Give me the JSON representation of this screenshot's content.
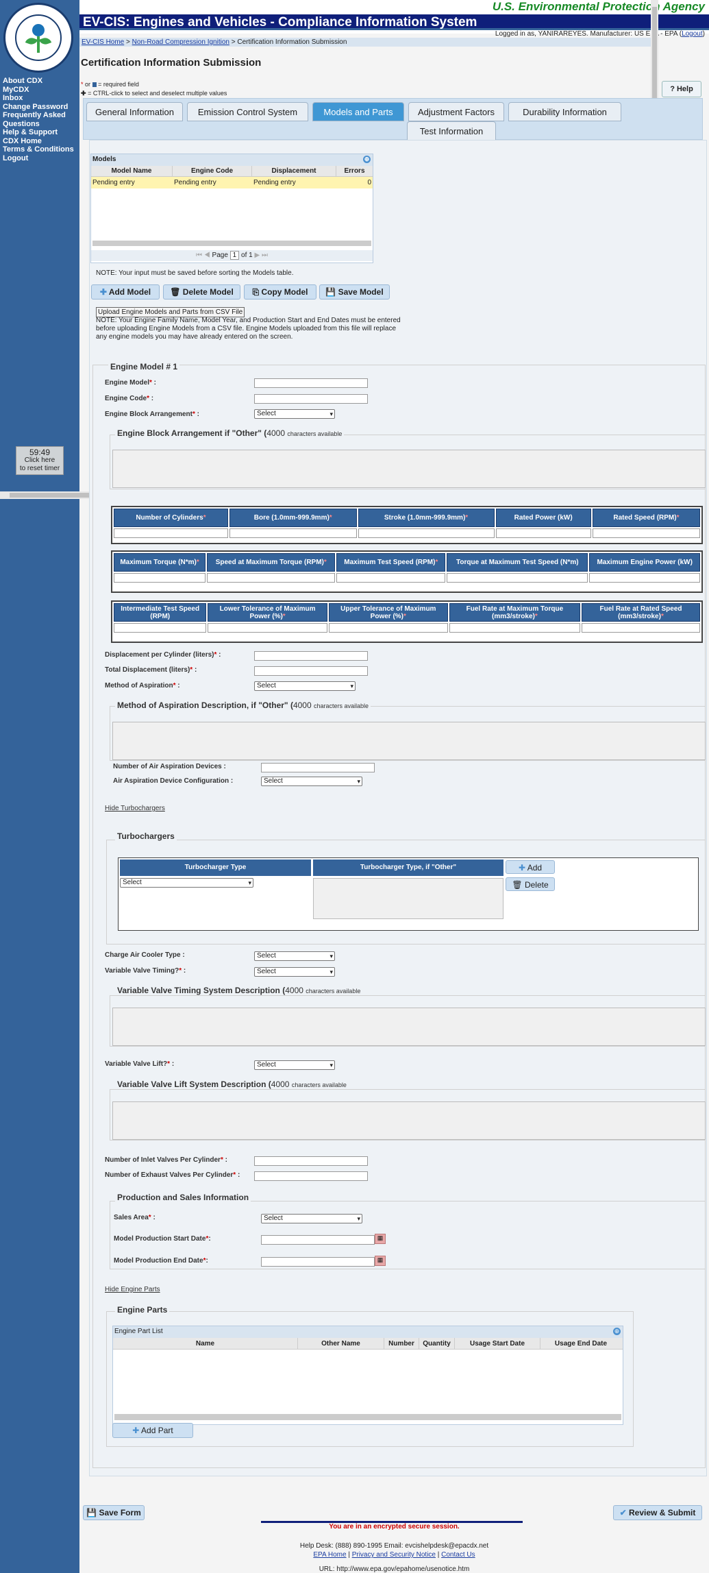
{
  "header": {
    "agency": "U.S. Environmental Protection Agency",
    "title": "EV-CIS: Engines and Vehicles - Compliance Information System",
    "logged_in_prefix": "Logged in as, YANIRAREYES. Manufacturer: US EPA - EPA (",
    "logout": "Logout",
    "logged_in_suffix": ")"
  },
  "seal": {
    "text": "UNITED STATES · ENVIRONMENTAL PROTECTION AGENCY"
  },
  "sidebar": {
    "items": [
      {
        "label": "About CDX"
      },
      {
        "label": "MyCDX"
      },
      {
        "label": "Inbox"
      },
      {
        "label": "Change Password"
      },
      {
        "label": "Frequently Asked Questions"
      },
      {
        "label": "Help & Support"
      },
      {
        "label": "CDX Home"
      },
      {
        "label": "Terms & Conditions"
      },
      {
        "label": "Logout"
      }
    ]
  },
  "timer": {
    "time": "59:49",
    "line1": "Click here",
    "line2": "to reset timer"
  },
  "breadcrumb": {
    "home": "EV-CIS Home",
    "sep": ">",
    "nrci": "Non-Road Compression Ignition",
    "current": "Certification Information Submission"
  },
  "page": {
    "title": "Certification Information Submission",
    "req_line": "= required field",
    "ctrl_line": "= CTRL-click to select and deselect multiple values",
    "req_prefix": "or",
    "help": "? Help"
  },
  "tabs": [
    {
      "label": "General Information"
    },
    {
      "label": "Emission Control System"
    },
    {
      "label": "Models and Parts"
    },
    {
      "label": "Adjustment Factors"
    },
    {
      "label": "Durability Information"
    },
    {
      "label": "Test Information"
    }
  ],
  "models": {
    "title": "Models",
    "columns": [
      "Model Name",
      "Engine Code",
      "Displacement",
      "Errors"
    ],
    "row": [
      "Pending entry",
      "Pending entry",
      "Pending entry",
      "0"
    ],
    "pager_prefix": "Page",
    "pager_page": "1",
    "pager_suffix": "of 1",
    "note": "NOTE: Your input must be saved before sorting the Models table.",
    "add": "Add Model",
    "delete": "Delete Model",
    "copy": "Copy Model",
    "save": "Save Model",
    "upload": "Upload Engine Models and Parts from CSV File",
    "upload_note": "NOTE: Your Engine Family Name, Model Year, and Production Start and End Dates must be entered before uploading Engine Models from a CSV file. Engine Models uploaded from this file will replace any engine models you may have already entered on the screen."
  },
  "engine": {
    "legend": "Engine Model # 1",
    "engine_model": "Engine Model",
    "engine_code": "Engine Code",
    "block_arr": "Engine Block Arrangement",
    "select": "Select",
    "block_other": "Engine Block Arrangement if \"Other\"",
    "chars": "4000",
    "chars_label": "characters available",
    "row1": [
      "Number of Cylinders",
      "Bore (1.0mm-999.9mm)",
      "Stroke (1.0mm-999.9mm)",
      "Rated Power (kW)",
      "Rated Speed (RPM)"
    ],
    "row2": [
      "Maximum Torque (N*m)",
      "Speed at Maximum Torque (RPM)",
      "Maximum Test Speed (RPM)",
      "Torque at Maximum Test Speed (N*m)",
      "Maximum Engine Power (kW)"
    ],
    "row3": [
      "Intermediate Test Speed (RPM)",
      "Lower Tolerance of Maximum Power (%)",
      "Upper Tolerance of Maximum Power (%)",
      "Fuel Rate at Maximum Torque (mm3/stroke)",
      "Fuel Rate at Rated Speed (mm3/stroke)"
    ],
    "disp_per_cyl": "Displacement per Cylinder (liters)",
    "total_disp": "Total Displacement (liters)",
    "aspiration": "Method of Aspiration",
    "aspiration_other": "Method of Aspiration Description, if \"Other\"",
    "num_air": "Number of Air Aspiration Devices",
    "air_config": "Air Aspiration Device Configuration",
    "hide_turbo": "Hide Turbochargers",
    "turbo_title": "Turbochargers",
    "turbo_type": "Turbocharger Type",
    "turbo_other": "Turbocharger Type, if \"Other\"",
    "add": "Add",
    "delete": "Delete",
    "charge_air": "Charge Air Cooler Type",
    "vvt": "Variable Valve Timing?",
    "vvt_desc": "Variable Valve Timing System Description",
    "vvl": "Variable Valve Lift?",
    "vvl_desc": "Variable Valve Lift System Description",
    "inlet": "Number of Inlet Valves Per Cylinder",
    "exhaust": "Number of Exhaust Valves Per Cylinder",
    "prod_title": "Production and Sales Information",
    "sales": "Sales Area",
    "start": "Model Production Start Date",
    "end": "Model Production End Date",
    "hide_parts": "Hide Engine Parts",
    "parts_title": "Engine Parts",
    "parts_list": "Engine Part List",
    "parts_cols": [
      "Name",
      "Other Name",
      "Number",
      "Quantity",
      "Usage Start Date",
      "Usage End Date"
    ],
    "add_part": "Add Part"
  },
  "footer": {
    "save_form": "Save Form",
    "review": "Review & Submit",
    "secure": "You are in an encrypted secure session.",
    "helpdesk": "Help Desk: (888) 890-1995   Email: evcishelpdesk@epacdx.net",
    "epa_home": "EPA Home",
    "privacy": "Privacy and Security Notice",
    "contact": "Contact Us",
    "url": "URL: http://www.epa.gov/epahome/usenotice.htm"
  }
}
